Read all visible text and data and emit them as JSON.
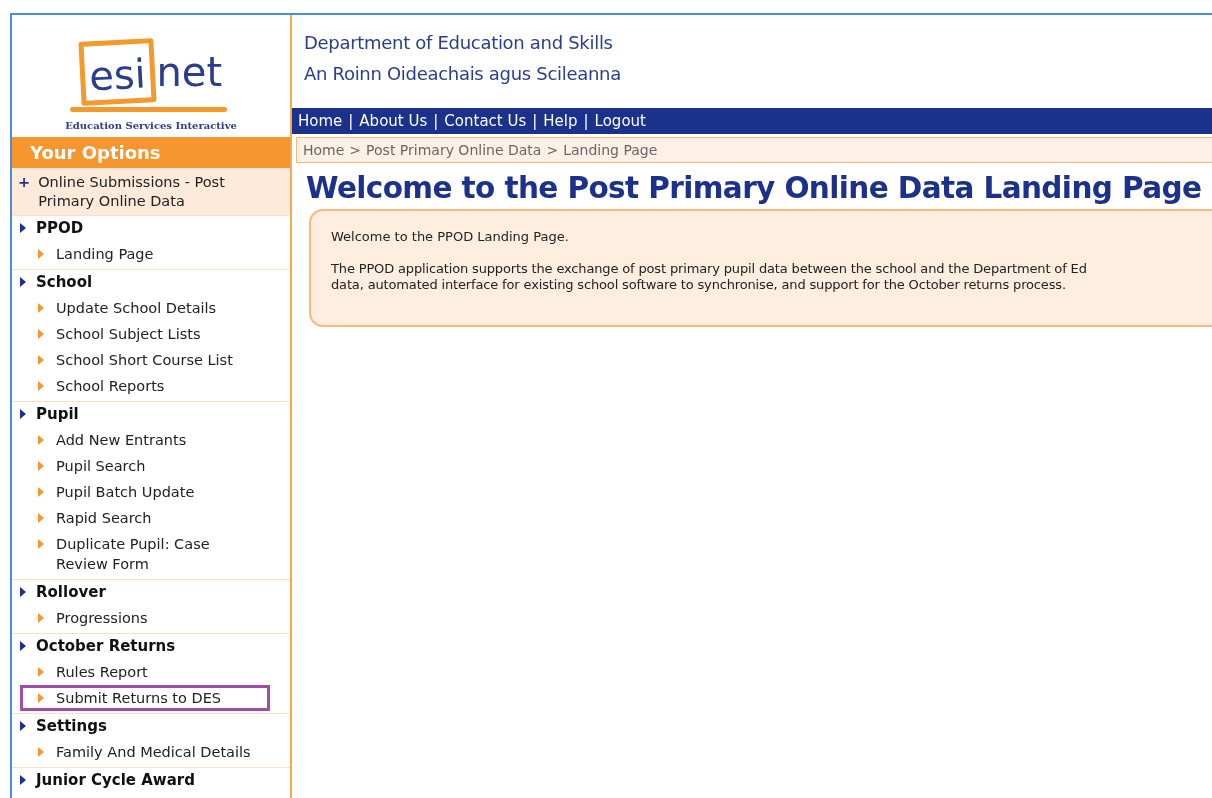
{
  "logo": {
    "part_boxed": "esi",
    "part_plain": "net",
    "tagline": "Education Services Interactive"
  },
  "header": {
    "lines": [
      "Department of Education and Skills",
      "An Roinn Oideachais agus Scileanna"
    ]
  },
  "nav": [
    "Home",
    "About Us",
    "Contact Us",
    "Help",
    "Logout"
  ],
  "nav_separator": "|",
  "sidebar": {
    "title": "Your Options",
    "top_item": {
      "icon": "+",
      "label": "Online Submissions - Post Primary Online Data"
    },
    "sections": [
      {
        "label": "PPOD",
        "items": [
          {
            "label": "Landing Page",
            "highlighted": false
          }
        ]
      },
      {
        "label": "School",
        "items": [
          {
            "label": "Update School Details",
            "highlighted": false
          },
          {
            "label": "School Subject Lists",
            "highlighted": false
          },
          {
            "label": "School Short Course List",
            "highlighted": false
          },
          {
            "label": "School Reports",
            "highlighted": false
          }
        ]
      },
      {
        "label": "Pupil",
        "items": [
          {
            "label": "Add New Entrants",
            "highlighted": false
          },
          {
            "label": "Pupil Search",
            "highlighted": false
          },
          {
            "label": "Pupil Batch Update",
            "highlighted": false
          },
          {
            "label": "Rapid Search",
            "highlighted": false
          },
          {
            "label": "Duplicate Pupil: Case Review Form",
            "highlighted": false
          }
        ]
      },
      {
        "label": "Rollover",
        "items": [
          {
            "label": "Progressions",
            "highlighted": false
          }
        ]
      },
      {
        "label": "October Returns",
        "items": [
          {
            "label": "Rules Report",
            "highlighted": false
          },
          {
            "label": "Submit Returns to DES",
            "highlighted": true
          }
        ]
      },
      {
        "label": "Settings",
        "items": [
          {
            "label": "Family And Medical Details",
            "highlighted": false
          }
        ]
      },
      {
        "label": "Junior Cycle Award"
      }
    ]
  },
  "breadcrumb": [
    "Home",
    "Post Primary Online Data",
    "Landing Page"
  ],
  "breadcrumb_separator": ">",
  "title": "Welcome to the Post Primary Online Data Landing Page",
  "panel": {
    "greeting": "Welcome to the PPOD Landing Page.",
    "paragraph_lines": [
      "The PPOD application supports the exchange of post primary pupil data between the school and the Department of Ed",
      "data, automated interface for existing school software to synchronise, and support for the October returns process."
    ]
  }
}
